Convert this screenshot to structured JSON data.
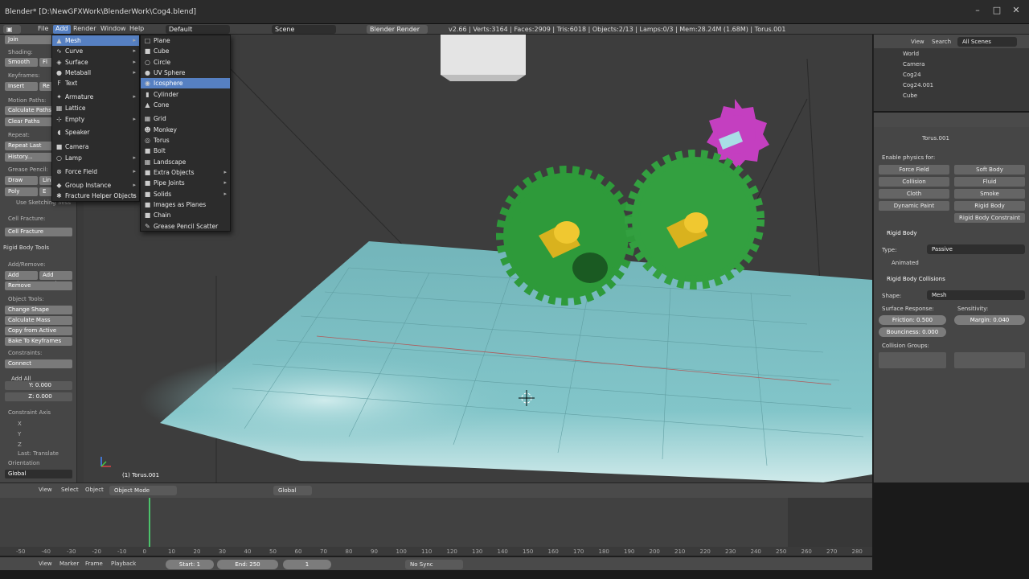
{
  "window": {
    "title": "Blender* [D:\\NewGFXWork\\BlenderWork\\Cog4.blend]",
    "controls": [
      "–",
      "□",
      "✕"
    ]
  },
  "infobar": {
    "menus": [
      "File",
      "Add",
      "Render",
      "Window",
      "Help"
    ],
    "layout": "Default",
    "scene": "Scene",
    "engine": "Blender Render",
    "stats": "v2.66 | Verts:3164 | Faces:2909 | Tris:6018 | Objects:2/13 | Lamps:0/3 | Mem:28.24M (1.68M) | Torus.001"
  },
  "add_menu": {
    "items": [
      {
        "label": "Mesh",
        "icon": "mesh-icon",
        "sub": true,
        "hl": true
      },
      {
        "label": "Curve",
        "icon": "curve-icon",
        "sub": true
      },
      {
        "label": "Surface",
        "icon": "surface-icon",
        "sub": true
      },
      {
        "label": "Metaball",
        "icon": "metaball-icon",
        "sub": true
      },
      {
        "label": "Text",
        "icon": "text-icon",
        "sub": false
      },
      {
        "label": "Armature",
        "icon": "armature-icon",
        "sub": true
      },
      {
        "label": "Lattice",
        "icon": "lattice-icon",
        "sub": false
      },
      {
        "label": "Empty",
        "icon": "empty-icon",
        "sub": true
      },
      {
        "label": "Speaker",
        "icon": "speaker-icon",
        "sub": false
      },
      {
        "label": "Camera",
        "icon": "camera-icon",
        "sub": false
      },
      {
        "label": "Lamp",
        "icon": "lamp-icon",
        "sub": true
      },
      {
        "label": "Force Field",
        "icon": "force-field-icon",
        "sub": true
      },
      {
        "label": "Group Instance",
        "icon": "group-instance-icon",
        "sub": true
      },
      {
        "label": "Fracture Helper Objects",
        "icon": "fracture-icon",
        "sub": true
      }
    ]
  },
  "mesh_menu": {
    "items": [
      {
        "label": "Plane",
        "icon": "plane-icon"
      },
      {
        "label": "Cube",
        "icon": "cube-icon"
      },
      {
        "label": "Circle",
        "icon": "circle-icon"
      },
      {
        "label": "UV Sphere",
        "icon": "uv-sphere-icon"
      },
      {
        "label": "Icosphere",
        "icon": "icosphere-icon",
        "hl": true
      },
      {
        "label": "Cylinder",
        "icon": "cylinder-icon"
      },
      {
        "label": "Cone",
        "icon": "cone-icon"
      },
      {
        "label": "Grid",
        "icon": "grid-icon"
      },
      {
        "label": "Monkey",
        "icon": "monkey-icon"
      },
      {
        "label": "Torus",
        "icon": "torus-icon"
      },
      {
        "label": "Bolt",
        "icon": "bolt-icon"
      },
      {
        "label": "Landscape",
        "icon": "landscape-icon"
      },
      {
        "label": "Extra Objects",
        "icon": "extra-objects-icon",
        "sub": true
      },
      {
        "label": "Pipe Joints",
        "icon": "pipe-joints-icon",
        "sub": true
      },
      {
        "label": "Solids",
        "icon": "solids-icon",
        "sub": true
      },
      {
        "label": "Images as Planes",
        "icon": "images-planes-icon"
      },
      {
        "label": "Chain",
        "icon": "chain-icon"
      },
      {
        "label": "Grease Pencil Scatter",
        "icon": "grease-pencil-icon"
      }
    ]
  },
  "toolshelf": {
    "join": "Join",
    "shading": "Shading:",
    "smooth": "Smooth",
    "flat": "Fl",
    "keyframes": "Keyframes:",
    "insert": "Insert",
    "remove_kf": "Re",
    "motion_paths": "Motion Paths:",
    "calc_paths": "Calculate Paths",
    "clear_paths": "Clear Paths",
    "repeat": "Repeat:",
    "repeat_last": "Repeat Last",
    "history": "History...",
    "grease_pencil": "Grease Pencil:",
    "draw": "Draw",
    "line": "Lin",
    "poly": "Poly",
    "erase": "E",
    "use_sketching": "Use Sketching Sess",
    "cell_fracture_h": "Cell Fracture:",
    "cell_fracture": "Cell Fracture",
    "rigid_body_tools": "Rigid Body Tools",
    "add_remove": "Add/Remove:",
    "add_active": "Add Active",
    "add_passive": "Add Passiv",
    "remove": "Remove",
    "object_tools": "Object Tools:",
    "change_shape": "Change Shape",
    "calc_mass": "Calculate Mass",
    "copy_active": "Copy from Active",
    "bake_kf": "Bake To Keyframes",
    "constraints": "Constraints:",
    "connect": "Connect",
    "add_all": "Add All",
    "y_val": "Y: 0.000",
    "z_val": "Z: 0.000",
    "constraint_axis": "Constraint Axis",
    "x": "X",
    "y": "Y",
    "z": "Z",
    "last": "Last: Translate",
    "orientation": "Orientation",
    "global": "Global"
  },
  "viewport": {
    "object_label": "(1) Torus.001"
  },
  "outliner": {
    "view": "View",
    "search": "Search",
    "scenes": "All Scenes",
    "rows": [
      "World",
      "Camera",
      "Cog24",
      "Cog24.001",
      "Cube"
    ]
  },
  "properties": {
    "object": "Torus.001",
    "enable_physics": "Enable physics for:",
    "buttons": [
      "Force Field",
      "Soft Body",
      "Collision",
      "Fluid",
      "Cloth",
      "Smoke",
      "Dynamic Paint",
      "Rigid Body",
      "Rigid Body Constraint"
    ],
    "rigid_body": "Rigid Body",
    "type_label": "Type:",
    "type_value": "Passive",
    "animated": "Animated",
    "rb_collisions": "Rigid Body Collisions",
    "shape_label": "Shape:",
    "shape_value": "Mesh",
    "surface_response": "Surface Response:",
    "sensitivity": "Sensitivity:",
    "friction": "Friction: 0.500",
    "margin": "Margin: 0.040",
    "bounciness": "Bounciness: 0.000",
    "collision_groups": "Collision Groups:"
  },
  "vp_header": {
    "view": "View",
    "select": "Select",
    "object": "Object",
    "mode": "Object Mode",
    "global": "Global"
  },
  "timeline": {
    "ticks": [
      "-50",
      "-40",
      "-30",
      "-20",
      "-10",
      "0",
      "10",
      "20",
      "30",
      "40",
      "50",
      "60",
      "70",
      "80",
      "90",
      "100",
      "110",
      "120",
      "130",
      "140",
      "150",
      "160",
      "170",
      "180",
      "190",
      "200",
      "210",
      "220",
      "230",
      "240",
      "250",
      "260",
      "270",
      "280"
    ],
    "view": "View",
    "marker": "Marker",
    "frame": "Frame",
    "playback": "Playback",
    "start": "Start: 1",
    "end": "End: 250",
    "current": "1",
    "sync": "No Sync"
  },
  "colors": {
    "accent": "#5680c2",
    "gear_green": "#2e9a3a",
    "gear_magenta": "#c43fc0",
    "axle_yellow": "#d9b21e",
    "floor": "#7fc3c8"
  }
}
